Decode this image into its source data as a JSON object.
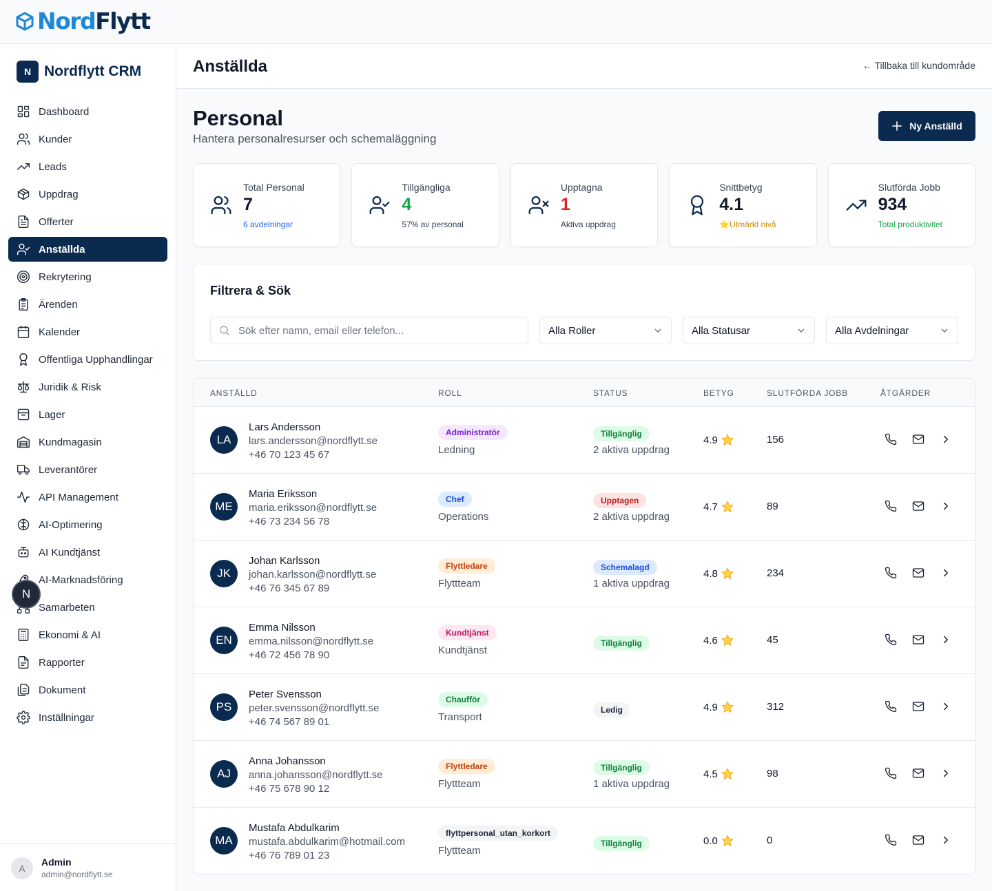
{
  "brand": {
    "logo_part1": "Nord",
    "logo_part2": "Flytt",
    "badge": "N",
    "name": "Nordflytt CRM"
  },
  "sidebar": {
    "items": [
      {
        "label": "Dashboard",
        "icon": "dashboard-icon"
      },
      {
        "label": "Kunder",
        "icon": "users-icon"
      },
      {
        "label": "Leads",
        "icon": "trending-up-icon"
      },
      {
        "label": "Uppdrag",
        "icon": "package-icon"
      },
      {
        "label": "Offerter",
        "icon": "document-icon"
      },
      {
        "label": "Anställda",
        "icon": "user-check-icon",
        "active": true
      },
      {
        "label": "Rekrytering",
        "icon": "target-icon"
      },
      {
        "label": "Ärenden",
        "icon": "clipboard-icon"
      },
      {
        "label": "Kalender",
        "icon": "calendar-icon"
      },
      {
        "label": "Offentliga Upphandlingar",
        "icon": "award-icon"
      },
      {
        "label": "Juridik & Risk",
        "icon": "scale-icon"
      },
      {
        "label": "Lager",
        "icon": "archive-icon"
      },
      {
        "label": "Kundmagasin",
        "icon": "warehouse-icon"
      },
      {
        "label": "Leverantörer",
        "icon": "truck-icon"
      },
      {
        "label": "API Management",
        "icon": "activity-icon"
      },
      {
        "label": "AI-Optimering",
        "icon": "brain-icon"
      },
      {
        "label": "AI Kundtjänst",
        "icon": "bot-icon"
      },
      {
        "label": "AI-Marknadsföring",
        "icon": "rocket-icon"
      },
      {
        "label": "Samarbeten",
        "icon": "network-icon"
      },
      {
        "label": "Ekonomi & AI",
        "icon": "calculator-icon"
      },
      {
        "label": "Rapporter",
        "icon": "file-text-icon"
      },
      {
        "label": "Dokument",
        "icon": "file-stack-icon"
      },
      {
        "label": "Inställningar",
        "icon": "gear-icon"
      }
    ],
    "user": {
      "initial": "A",
      "name": "Admin",
      "email": "admin@nordflytt.se"
    },
    "floating_badge": "N"
  },
  "header": {
    "title": "Anställda",
    "back_link": "← Tillbaka till kundområde"
  },
  "page": {
    "heading": "Personal",
    "subtitle": "Hantera personalresurser och schemaläggning",
    "new_button": "Ny Anställd"
  },
  "stats": [
    {
      "label": "Total Personal",
      "value": "7",
      "sub": "6 avdelningar",
      "value_color": "#111827",
      "sub_color": "#2563eb",
      "icon": "users-icon"
    },
    {
      "label": "Tillgängliga",
      "value": "4",
      "sub": "57% av personal",
      "value_color": "#16a34a",
      "sub_color": "#374151",
      "icon": "user-check-icon"
    },
    {
      "label": "Upptagna",
      "value": "1",
      "sub": "Aktiva uppdrag",
      "value_color": "#dc2626",
      "sub_color": "#374151",
      "icon": "user-x-icon"
    },
    {
      "label": "Snittbetyg",
      "value": "4.1",
      "sub": "⭐Utmärkt nivå",
      "value_color": "#111827",
      "sub_color": "#ca8a04",
      "icon": "award-icon"
    },
    {
      "label": "Slutförda Jobb",
      "value": "934",
      "sub": "Total produktivitet",
      "value_color": "#111827",
      "sub_color": "#16a34a",
      "icon": "trending-up-icon"
    }
  ],
  "filters": {
    "title": "Filtrera & Sök",
    "search_placeholder": "Sök efter namn, email eller telefon...",
    "role": "Alla Roller",
    "status": "Alla Statusar",
    "department": "Alla Avdelningar"
  },
  "table": {
    "columns": [
      "ANSTÄLLD",
      "ROLL",
      "STATUS",
      "BETYG",
      "SLUTFÖRDA JOBB",
      "ÅTGÄRDER"
    ],
    "rows": [
      {
        "initials": "LA",
        "name": "Lars Andersson",
        "email": "lars.andersson@nordflytt.se",
        "phone": "+46 70 123 45 67",
        "role": "Administratör",
        "role_bg": "#f3e8ff",
        "role_fg": "#7e22ce",
        "department": "Ledning",
        "status": "Tillgänglig",
        "status_bg": "#dcfce7",
        "status_fg": "#15803d",
        "status_sub": "2 aktiva uppdrag",
        "rating": "4.9",
        "jobs": "156"
      },
      {
        "initials": "ME",
        "name": "Maria Eriksson",
        "email": "maria.eriksson@nordflytt.se",
        "phone": "+46 73 234 56 78",
        "role": "Chef",
        "role_bg": "#dbeafe",
        "role_fg": "#1d4ed8",
        "department": "Operations",
        "status": "Upptagen",
        "status_bg": "#fee2e2",
        "status_fg": "#b91c1c",
        "status_sub": "2 aktiva uppdrag",
        "rating": "4.7",
        "jobs": "89"
      },
      {
        "initials": "JK",
        "name": "Johan Karlsson",
        "email": "johan.karlsson@nordflytt.se",
        "phone": "+46 76 345 67 89",
        "role": "Flyttledare",
        "role_bg": "#ffedd5",
        "role_fg": "#c2410c",
        "department": "Flyttteam",
        "status": "Schemalagd",
        "status_bg": "#dbeafe",
        "status_fg": "#1d4ed8",
        "status_sub": "1 aktiva uppdrag",
        "rating": "4.8",
        "jobs": "234"
      },
      {
        "initials": "EN",
        "name": "Emma Nilsson",
        "email": "emma.nilsson@nordflytt.se",
        "phone": "+46 72 456 78 90",
        "role": "Kundtjänst",
        "role_bg": "#fce7f3",
        "role_fg": "#be185d",
        "department": "Kundtjänst",
        "status": "Tillgänglig",
        "status_bg": "#dcfce7",
        "status_fg": "#15803d",
        "status_sub": "",
        "rating": "4.6",
        "jobs": "45"
      },
      {
        "initials": "PS",
        "name": "Peter Svensson",
        "email": "peter.svensson@nordflytt.se",
        "phone": "+46 74 567 89 01",
        "role": "Chaufför",
        "role_bg": "#dcfce7",
        "role_fg": "#15803d",
        "department": "Transport",
        "status": "Ledig",
        "status_bg": "#f3f4f6",
        "status_fg": "#1f2937",
        "status_sub": "",
        "rating": "4.9",
        "jobs": "312"
      },
      {
        "initials": "AJ",
        "name": "Anna Johansson",
        "email": "anna.johansson@nordflytt.se",
        "phone": "+46 75 678 90 12",
        "role": "Flyttledare",
        "role_bg": "#ffedd5",
        "role_fg": "#c2410c",
        "department": "Flyttteam",
        "status": "Tillgänglig",
        "status_bg": "#dcfce7",
        "status_fg": "#15803d",
        "status_sub": "1 aktiva uppdrag",
        "rating": "4.5",
        "jobs": "98"
      },
      {
        "initials": "MA",
        "name": "Mustafa Abdulkarim",
        "email": "mustafa.abdulkarim@hotmail.com",
        "phone": "+46 76 789 01 23",
        "role": "flyttpersonal_utan_korkort",
        "role_bg": "#f3f4f6",
        "role_fg": "#1f2937",
        "department": "Flyttteam",
        "status": "Tillgänglig",
        "status_bg": "#dcfce7",
        "status_fg": "#15803d",
        "status_sub": "",
        "rating": "0.0",
        "jobs": "0"
      }
    ]
  }
}
